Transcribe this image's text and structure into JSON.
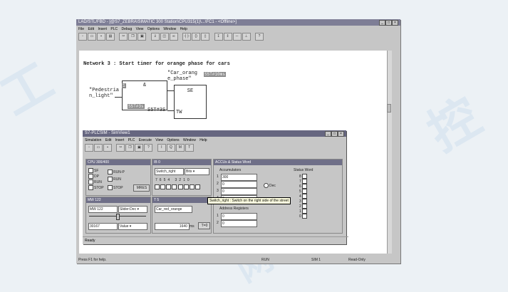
{
  "editor": {
    "title": "LAD/STL/FBD - [@S7_ZEBRA\\SIMATIC 300 Station\\CPU315(1)\\...\\FC1 - <Offline>]",
    "menu": [
      "File",
      "Edit",
      "Insert",
      "PLC",
      "Debug",
      "View",
      "Options",
      "Window",
      "Help"
    ],
    "network_title": "Network 3 : Start timer for orange phase for cars",
    "tag_car_orange": "\"Car_orang\ne_phase\"",
    "timer_addr": "S5T#10ms",
    "and_label": "&",
    "ped_addr": "1",
    "ped_light": "\"Pedestria\nn_light\"",
    "time_value": "S5T#3s",
    "tw_value": "S5T#3S",
    "se_label": "SE",
    "tw_label": "TW",
    "status_help": "Press F1 for help.",
    "status_mode": "RUN",
    "status_sim": "SIM 1",
    "status_access": "Read-Only"
  },
  "sim": {
    "title": "S7-PLCSIM - SimView1",
    "menu": [
      "Simulation",
      "Edit",
      "Insert",
      "PLC",
      "Execute",
      "View",
      "Options",
      "Window",
      "Help"
    ],
    "cpu": {
      "title": "CPU 300/400",
      "modes": [
        "SF",
        "DP",
        "RUN",
        "STOP"
      ],
      "switches": [
        "RUN-P",
        "RUN",
        "STOP"
      ],
      "mres": "MRES"
    },
    "ib": {
      "title": "IB 0",
      "address": "Switch_right",
      "format": "Bits",
      "bits": [
        "7",
        "6",
        "5",
        "4",
        "3",
        "2",
        "1",
        "0"
      ]
    },
    "mw": {
      "title": "MW 122",
      "address": "MW 122",
      "format": "Slider:Dec",
      "value": "30167",
      "value_type": "Value"
    },
    "timer": {
      "title": "T 5",
      "address": "Car_red_orange",
      "value": "1640",
      "unit": "ms",
      "reset": "T=0"
    },
    "accus": {
      "title": "ACCUs & Status Word",
      "accumulators_label": "Accumulators",
      "accu_values": [
        "300",
        "0",
        "0",
        "0"
      ],
      "accu_index": [
        "1",
        "2",
        "3",
        "4"
      ],
      "format": "Dec",
      "status_word_label": "Status Word",
      "status_bits": [
        "8",
        "7",
        "6",
        "5",
        "4",
        "3",
        "2",
        "1",
        "0"
      ],
      "address_registers_label": "Address Registers",
      "ar_values": [
        "0",
        "0"
      ],
      "ar_index": [
        "1",
        "2"
      ]
    },
    "tooltip": "Switch_right : Switch on the right side of the street",
    "status": "Ready"
  }
}
